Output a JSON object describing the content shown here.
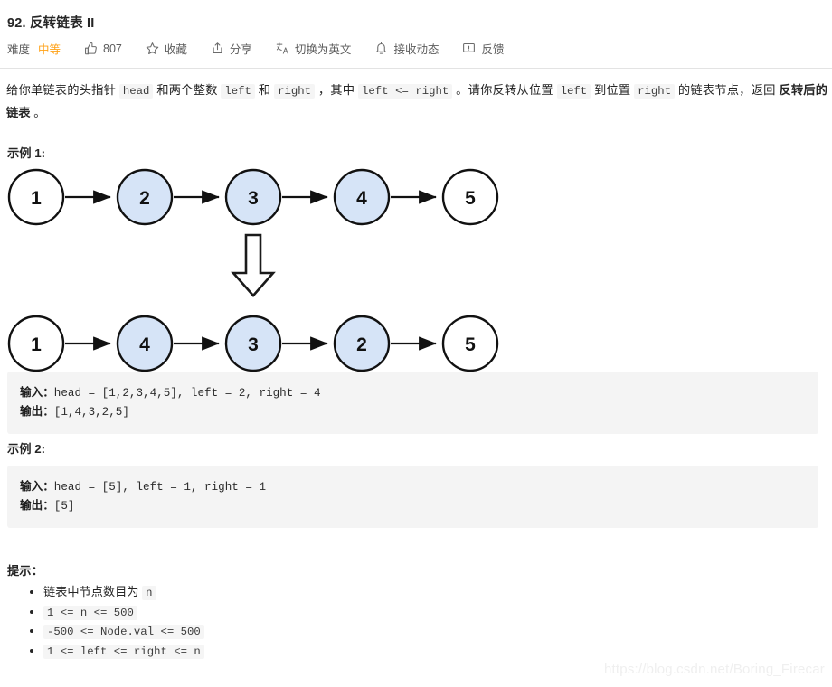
{
  "header": {
    "title": "92. 反转链表 II",
    "difficulty_label": "难度",
    "difficulty_value": "中等",
    "likes_count": "807",
    "favorite_label": "收藏",
    "share_label": "分享",
    "translate_label": "切换为英文",
    "subscribe_label": "接收动态",
    "feedback_label": "反馈"
  },
  "description": {
    "p1": "给你单链表的头指针 ",
    "c1": "head",
    "p2": " 和两个整数 ",
    "c2": "left",
    "p3": " 和 ",
    "c3": "right",
    "p4": " ，其中 ",
    "c4": "left <= right",
    "p5": " 。请你反转从位置 ",
    "c5": "left",
    "p6": " 到位置 ",
    "c6": "right",
    "p7": " 的链表节点，返回 ",
    "bold1": "反转后的链表",
    "p8": " 。"
  },
  "examples": [
    {
      "heading": "示例 1:",
      "input_label": "输入：",
      "input_value": "head = [1,2,3,4,5], left = 2, right = 4",
      "output_label": "输出：",
      "output_value": "[1,4,3,2,5]"
    },
    {
      "heading": "示例 2:",
      "input_label": "输入：",
      "input_value": "head = [5], left = 1, right = 1",
      "output_label": "输出：",
      "output_value": "[5]"
    }
  ],
  "diagram": {
    "before": {
      "nodes": [
        {
          "value": "1",
          "highlighted": false
        },
        {
          "value": "2",
          "highlighted": true
        },
        {
          "value": "3",
          "highlighted": true
        },
        {
          "value": "4",
          "highlighted": true
        },
        {
          "value": "5",
          "highlighted": false
        }
      ]
    },
    "after": {
      "nodes": [
        {
          "value": "1",
          "highlighted": false
        },
        {
          "value": "4",
          "highlighted": true
        },
        {
          "value": "3",
          "highlighted": true
        },
        {
          "value": "2",
          "highlighted": true
        },
        {
          "value": "5",
          "highlighted": false
        }
      ]
    },
    "node_fill_highlighted": "#d6e4f7",
    "node_fill_plain": "#ffffff",
    "node_stroke": "#000000"
  },
  "hints": {
    "heading": "提示：",
    "items": [
      {
        "text": "链表中节点数目为 ",
        "code": "n",
        "code_only": false
      },
      {
        "text": "",
        "code": "1 <= n <= 500",
        "code_only": true
      },
      {
        "text": "",
        "code": "-500 <= Node.val <= 500",
        "code_only": true
      },
      {
        "text": "",
        "code": "1 <= left <= right <= n",
        "code_only": true
      }
    ]
  },
  "watermark": "https://blog.csdn.net/Boring_Firecar"
}
